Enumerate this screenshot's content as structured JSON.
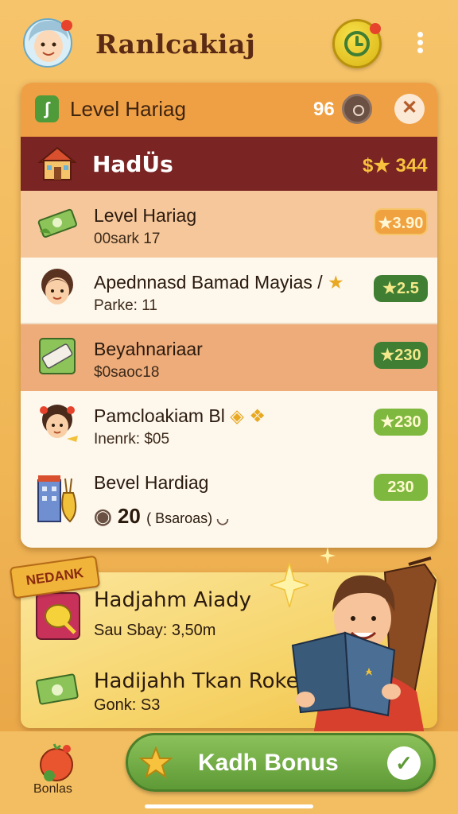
{
  "app": {
    "title": "Ranlcakiaj"
  },
  "panel": {
    "header_title": "Level Hariag",
    "header_count": "96",
    "section": {
      "title": "HadÜs",
      "score": "$★ 344"
    },
    "items": [
      {
        "name": "Level Hariag",
        "sub": "00sark 17",
        "reward": "★3.90"
      },
      {
        "name": "Apednnasd Bamad Mayias /",
        "sub": "Parke: 11",
        "reward": "★2.5"
      },
      {
        "name": "Beyahnariaar",
        "sub": "$0saoc18",
        "reward": "★230"
      },
      {
        "name": "Pamcloakiam Bl",
        "sub": "Inenrk: $05",
        "reward": "★230"
      },
      {
        "name": "Bevel Hardiag",
        "sub_value": "20",
        "sub_note": "( Bsaroas)",
        "reward": "230"
      }
    ]
  },
  "bonus": {
    "ribbon": "NEDANK",
    "items": [
      {
        "name": "Hadjahm Aiady",
        "sub": "Sau Sbay: 3,50m"
      },
      {
        "name": "Hadijahh Tkan Rokers",
        "sub": "Gonk: S3"
      }
    ]
  },
  "bottom": {
    "nav_label": "Bonlas",
    "claim_label": "Kadh Bonus"
  },
  "colors": {
    "accent_green": "#5e9a36",
    "header_maroon": "#7a2423",
    "panel_orange": "#f0a044"
  }
}
